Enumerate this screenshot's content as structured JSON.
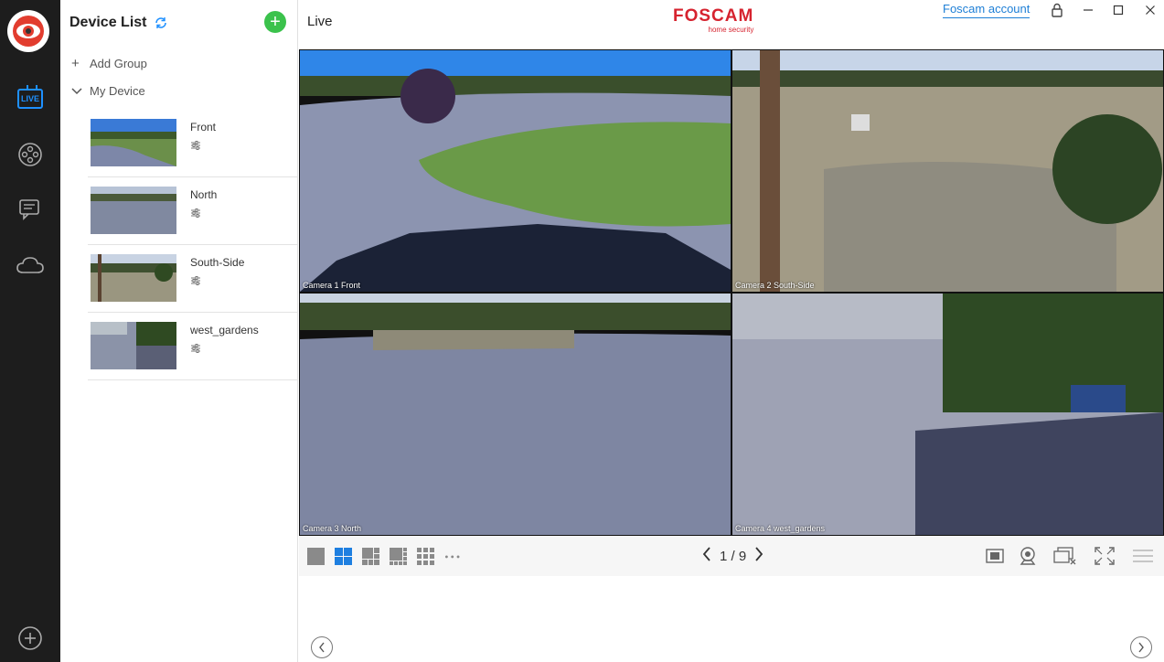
{
  "brand": {
    "name": "FOSCAM",
    "tagline": "home security"
  },
  "nav": {
    "live_label": "LIVE"
  },
  "device_panel": {
    "title": "Device List",
    "add_group": "Add Group",
    "my_device": "My Device",
    "devices": [
      {
        "name": "Front"
      },
      {
        "name": "North"
      },
      {
        "name": "South-Side"
      },
      {
        "name": "west_gardens"
      }
    ]
  },
  "header": {
    "title": "Live",
    "account": "Foscam account"
  },
  "cameras": [
    {
      "label": "Camera  1   Front"
    },
    {
      "label": "Camera  2  South-Side"
    },
    {
      "label": "Camera  3   North"
    },
    {
      "label": "Camera  4  west_gardens"
    }
  ],
  "pager": {
    "text": "1 / 9"
  },
  "colors": {
    "accent": "#1e90ff",
    "brand": "#d6232f",
    "add": "#3bc24c",
    "rail": "#1d1d1d"
  }
}
